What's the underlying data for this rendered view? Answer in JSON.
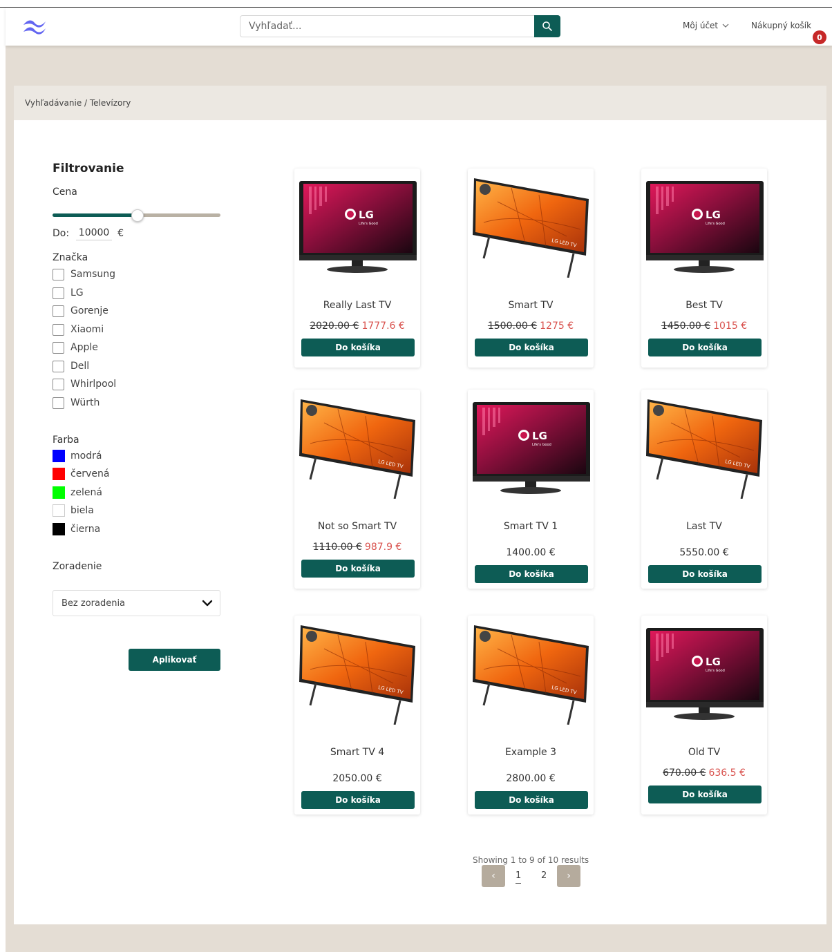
{
  "header": {
    "search_placeholder": "Vyhľadať...",
    "account_label": "Môj účet",
    "cart_label": "Nákupný košík",
    "cart_count": "0"
  },
  "breadcrumb": "Vyhľadávanie / Televízory",
  "filters": {
    "title": "Filtrovanie",
    "price_label": "Cena",
    "price_to_label": "Do:",
    "price_value": "10000",
    "price_slider_fraction": 0.5,
    "currency": "€",
    "brand_label": "Značka",
    "brands": [
      "Samsung",
      "LG",
      "Gorenje",
      "Xiaomi",
      "Apple",
      "Dell",
      "Whirlpool",
      "Würth"
    ],
    "color_label": "Farba",
    "colors": [
      {
        "label": "modrá",
        "hex": "#0000ff"
      },
      {
        "label": "červená",
        "hex": "#ff0000"
      },
      {
        "label": "zelená",
        "hex": "#00ff00"
      },
      {
        "label": "biela",
        "hex": "#ffffff"
      },
      {
        "label": "čierna",
        "hex": "#000000"
      }
    ],
    "sort_label": "Zoradenie",
    "sort_value": "Bez zoradenia",
    "apply_label": "Aplikovať"
  },
  "products": [
    {
      "name": "Really Last TV",
      "old_price": "2020.00 €",
      "price": "1777.6 €",
      "image": "lg-tv"
    },
    {
      "name": "Smart TV",
      "old_price": "1500.00 €",
      "price": "1275 €",
      "image": "orange-tv"
    },
    {
      "name": "Best TV",
      "old_price": "1450.00 €",
      "price": "1015 €",
      "image": "lg-tv"
    },
    {
      "name": "Not so Smart TV",
      "old_price": "1110.00 €",
      "price": "987.9 €",
      "image": "orange-tv"
    },
    {
      "name": "Smart TV 1",
      "old_price": "",
      "price": "1400.00 €",
      "image": "lg-tv"
    },
    {
      "name": "Last TV",
      "old_price": "",
      "price": "5550.00 €",
      "image": "orange-tv"
    },
    {
      "name": "Smart TV 4",
      "old_price": "",
      "price": "2050.00 €",
      "image": "orange-tv"
    },
    {
      "name": "Example 3",
      "old_price": "",
      "price": "2800.00 €",
      "image": "orange-tv"
    },
    {
      "name": "Old TV",
      "old_price": "670.00 €",
      "price": "636.5 €",
      "image": "lg-tv"
    }
  ],
  "add_to_cart_label": "Do košíka",
  "tv_texts": {
    "lg_logo": "LG",
    "lg_tagline": "Life's Good",
    "led_label": "LG LED TV"
  },
  "pagination": {
    "results_text": "Showing 1 to 9 of 10 results",
    "pages": [
      "1",
      "2"
    ],
    "current": "1",
    "prev_icon": "‹",
    "next_icon": "›"
  }
}
